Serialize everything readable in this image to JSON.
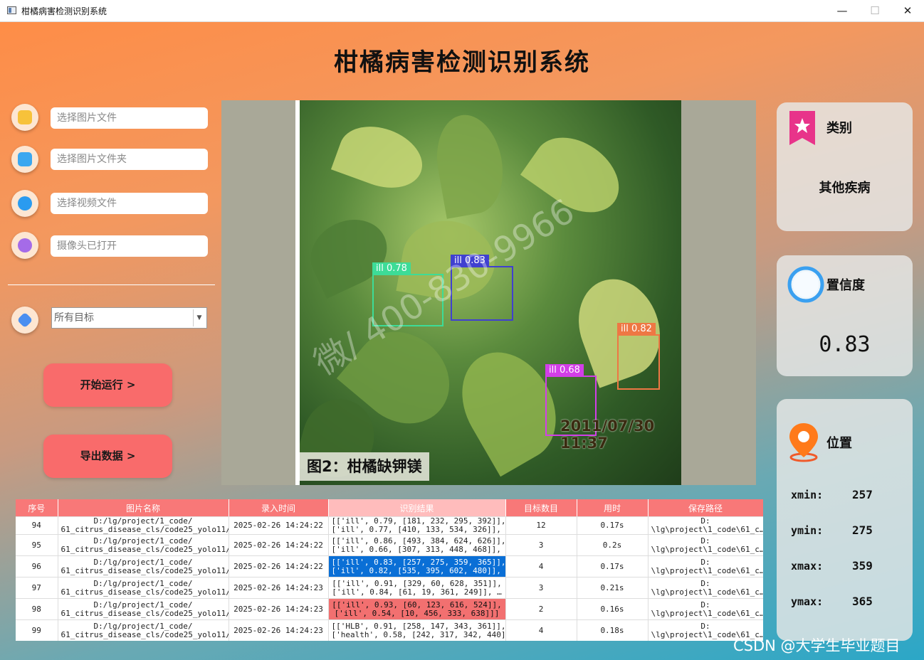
{
  "window": {
    "title": "柑橘病害检测识别系统",
    "min_label": "—",
    "max_label": "☐",
    "close_label": "✕"
  },
  "app_title": "柑橘病害检测识别系统",
  "sidebar": {
    "inputs": [
      {
        "placeholder": "选择图片文件",
        "icon": "image-file-icon",
        "color": "#f7c23a"
      },
      {
        "placeholder": "选择图片文件夹",
        "icon": "folder-add-icon",
        "color": "#3ba7f0"
      },
      {
        "placeholder": "选择视频文件",
        "icon": "video-file-icon",
        "color": "#2a9bf0"
      },
      {
        "placeholder": "摄像头已打开",
        "icon": "camera-icon",
        "color": "#a56be8"
      }
    ],
    "target_select": {
      "value": "所有目标",
      "icon": "tag-icon"
    },
    "start_button": "开始运行 >",
    "export_button": "导出数据 >"
  },
  "viewer": {
    "caption": "图2：柑橘缺钾镁",
    "timestamp": "2011/07/30 11:37",
    "watermark": "微/ 400-830-9966",
    "detections": [
      {
        "label": "ill 0.78",
        "color": "#3ddc97"
      },
      {
        "label": "ill 0.83",
        "color": "#4040d0"
      },
      {
        "label": "ill 0.82",
        "color": "#ee7744"
      },
      {
        "label": "ill 0.68",
        "color": "#d23ee8"
      }
    ]
  },
  "right_panel": {
    "category": {
      "title": "类别",
      "value": "其他疾病"
    },
    "confidence": {
      "title": "置信度",
      "value": "0.83"
    },
    "position": {
      "title": "位置",
      "xmin_label": "xmin:",
      "xmin": "257",
      "ymin_label": "ymin:",
      "ymin": "275",
      "xmax_label": "xmax:",
      "xmax": "359",
      "ymax_label": "ymax:",
      "ymax": "365"
    }
  },
  "table": {
    "headers": [
      "序号",
      "图片名称",
      "录入时间",
      "识别结果",
      "目标数目",
      "用时",
      "保存路径"
    ],
    "rows": [
      {
        "id": "94",
        "name": "D:/lg/project/1_code/\n61_citrus_disease_cls/code25_yolo11/…",
        "time": "2025-02-26 14:24:22",
        "result": "[['ill', 0.79, [181, 232, 295, 392]],\n['ill', 0.77, [410, 133, 534, 326]], …",
        "count": "12",
        "used": "0.17s",
        "path": "D:\n\\lg\\project\\1_code\\61_c…",
        "style": ""
      },
      {
        "id": "95",
        "name": "D:/lg/project/1_code/\n61_citrus_disease_cls/code25_yolo11/…",
        "time": "2025-02-26 14:24:22",
        "result": "[['ill', 0.86, [493, 384, 624, 626]],\n['ill', 0.66, [307, 313, 448, 468]], …",
        "count": "3",
        "used": "0.2s",
        "path": "D:\n\\lg\\project\\1_code\\61_c…",
        "style": ""
      },
      {
        "id": "96",
        "name": "D:/lg/project/1_code/\n61_citrus_disease_cls/code25_yolo11/…",
        "time": "2025-02-26 14:24:22",
        "result": "[['ill', 0.83, [257, 275, 359, 365]],\n['ill', 0.82, [535, 395, 602, 480]], …",
        "count": "4",
        "used": "0.17s",
        "path": "D:\n\\lg\\project\\1_code\\61_c…",
        "style": "blue"
      },
      {
        "id": "97",
        "name": "D:/lg/project/1_code/\n61_citrus_disease_cls/code25_yolo11/…",
        "time": "2025-02-26 14:24:23",
        "result": "[['ill', 0.91, [329, 60, 628, 351]],\n['ill', 0.84, [61, 19, 361, 249]], …",
        "count": "3",
        "used": "0.21s",
        "path": "D:\n\\lg\\project\\1_code\\61_c…",
        "style": ""
      },
      {
        "id": "98",
        "name": "D:/lg/project/1_code/\n61_citrus_disease_cls/code25_yolo11/…",
        "time": "2025-02-26 14:24:23",
        "result": "[['ill', 0.93, [60, 123, 616, 524]],\n['ill', 0.54, [10, 456, 333, 638]]]",
        "count": "2",
        "used": "0.16s",
        "path": "D:\n\\lg\\project\\1_code\\61_c…",
        "style": "red"
      },
      {
        "id": "99",
        "name": "D:/lg/project/1_code/\n61_citrus_disease_cls/code25_yolo11/…",
        "time": "2025-02-26 14:24:23",
        "result": "[['HLB', 0.91, [258, 147, 343, 361]],\n['health', 0.58, [242, 317, 342, 440]]…",
        "count": "4",
        "used": "0.18s",
        "path": "D:\n\\lg\\project\\1_code\\61_c…",
        "style": ""
      }
    ]
  },
  "footer_watermark": "CSDN @大学生毕业题目"
}
